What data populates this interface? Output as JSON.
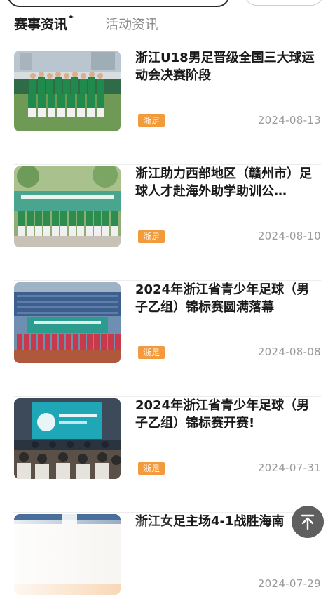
{
  "tabs": [
    {
      "label": "赛事资讯",
      "active": true
    },
    {
      "label": "活动资讯",
      "active": false
    }
  ],
  "news": [
    {
      "title": "浙江U18男足晋级全国三大球运动会决赛阶段",
      "tag": "浙足",
      "date": "2024-08-13"
    },
    {
      "title": "浙江助力西部地区（赣州市）足球人才赴海外助学助训公…",
      "tag": "浙足",
      "date": "2024-08-10"
    },
    {
      "title": "2024年浙江省青少年足球（男子乙组）锦标赛圆满落幕",
      "tag": "浙足",
      "date": "2024-08-08"
    },
    {
      "title": "2024年浙江省青少年足球（男子乙组）锦标赛开赛!",
      "tag": "浙足",
      "date": "2024-07-31"
    },
    {
      "title": "浙江女足主场4-1战胜海南",
      "tag": "",
      "date": "2024-07-29"
    }
  ],
  "colors": {
    "accent_green": "#2fb36a",
    "tag_orange": "#f39a3c",
    "date_gray": "#9a9a9a"
  },
  "icons": {
    "back_to_top": "arrow-up-to-line-icon",
    "tab_sparkle": "sparkle-icon"
  }
}
